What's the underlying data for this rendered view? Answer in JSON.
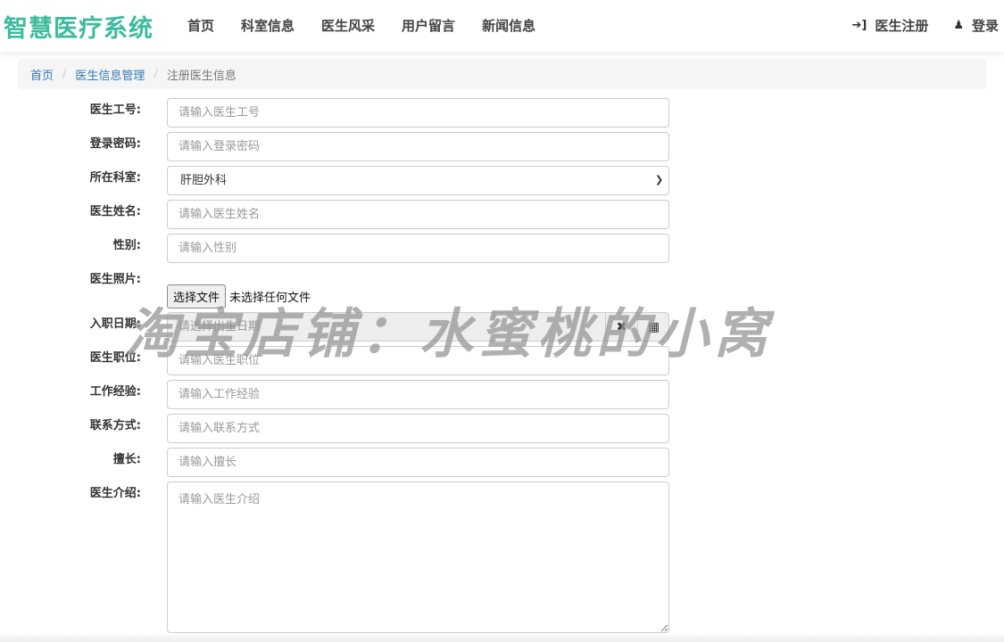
{
  "brand": "智慧医疗系统",
  "nav": {
    "items": [
      "首页",
      "科室信息",
      "医生风采",
      "用户留言",
      "新闻信息"
    ],
    "register": "医生注册",
    "login": "登录"
  },
  "breadcrumb": {
    "home": "首页",
    "manage": "医生信息管理",
    "current": "注册医生信息"
  },
  "form": {
    "id_label": "医生工号:",
    "id_placeholder": "请输入医生工号",
    "pwd_label": "登录密码:",
    "pwd_placeholder": "请输入登录密码",
    "dept_label": "所在科室:",
    "dept_value": "肝胆外科",
    "name_label": "医生姓名:",
    "name_placeholder": "请输入医生姓名",
    "sex_label": "性别:",
    "sex_placeholder": "请输入性别",
    "photo_label": "医生照片:",
    "photo_button": "选择文件",
    "photo_status": "未选择任何文件",
    "date_label": "入职日期:",
    "date_placeholder": "请选择出生日期",
    "pos_label": "医生职位:",
    "pos_placeholder": "请输入医生职位",
    "exp_label": "工作经验:",
    "exp_placeholder": "请输入工作经验",
    "contact_label": "联系方式:",
    "contact_placeholder": "请输入联系方式",
    "skill_label": "擅长:",
    "skill_placeholder": "请输入擅长",
    "intro_label": "医生介绍:",
    "intro_placeholder": "请输入医生介绍"
  },
  "watermark": "淘宝店铺：水蜜桃的小窝",
  "colors": {
    "brand": "#3cbb9d",
    "link": "#337ab7"
  },
  "icons": {
    "register": "sign-in-icon",
    "login": "user-icon",
    "clear": "times-icon",
    "calendar": "calendar-icon",
    "dropdown": "chevron-down-icon"
  }
}
